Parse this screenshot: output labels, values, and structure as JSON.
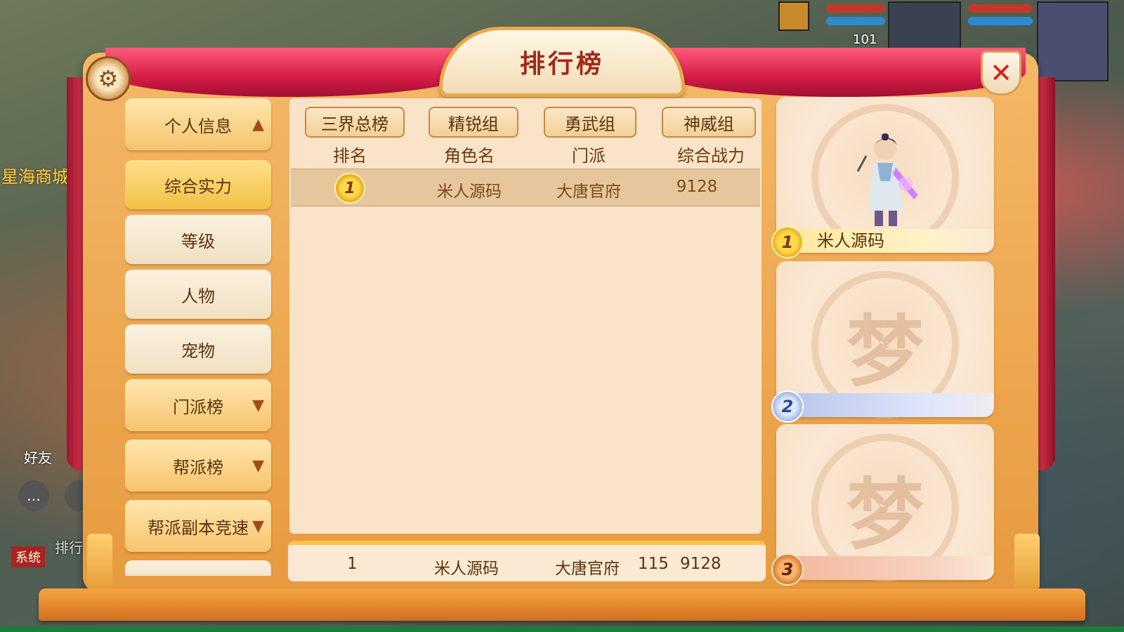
{
  "window": {
    "title": "排行榜",
    "close_label": "✕",
    "settings_label": "⚙"
  },
  "background": {
    "shop_label": "星海商城",
    "friends_label": "好友",
    "system_tag": "系统",
    "ranking_label": "排行",
    "level_value": "101"
  },
  "menu": {
    "items": [
      {
        "label": "个人信息",
        "chevron": "▲"
      },
      {
        "label": "综合实力"
      },
      {
        "label": "等级"
      },
      {
        "label": "人物"
      },
      {
        "label": "宠物"
      },
      {
        "label": "门派榜",
        "chevron": "▼"
      },
      {
        "label": "帮派榜",
        "chevron": "▼"
      },
      {
        "label": "帮派副本竞速",
        "chevron": "▼"
      }
    ]
  },
  "tabs": [
    {
      "label": "三界总榜"
    },
    {
      "label": "精锐组"
    },
    {
      "label": "勇武组"
    },
    {
      "label": "神威组"
    }
  ],
  "table": {
    "headers": [
      "排名",
      "角色名",
      "门派",
      "综合战力"
    ],
    "rows": [
      {
        "rank": "1",
        "name": "米人源码",
        "school": "大唐官府",
        "power": "9128"
      }
    ]
  },
  "self_row": {
    "rank": "1",
    "name": "米人源码",
    "school": "大唐官府",
    "level": "115",
    "power": "9128"
  },
  "podium": [
    {
      "rank": "1",
      "name": "米人源码"
    },
    {
      "rank": "2",
      "name": ""
    },
    {
      "rank": "3",
      "name": ""
    }
  ],
  "emblem_glyph": "梦",
  "colors": {
    "frame": "#e79a3e",
    "title_text": "#a3281a",
    "close_x": "#e01c1c",
    "selected_row": "#e6c69d"
  }
}
